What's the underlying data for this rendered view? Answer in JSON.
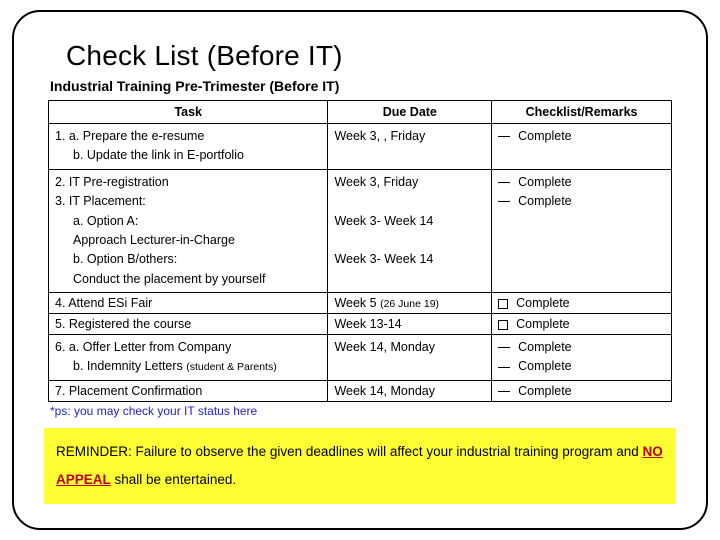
{
  "title": "Check List (Before IT)",
  "subtitle": "Industrial Training Pre-Trimester (Before IT)",
  "table": {
    "headers": {
      "task": "Task",
      "due": "Due Date",
      "remark": "Checklist/Remarks"
    },
    "rows": {
      "r1": {
        "task_a": "1.  a. Prepare the e-resume",
        "task_b": "b. Update the link in E-portfolio",
        "due": "Week 3, , Friday",
        "remark": "Complete"
      },
      "r2": {
        "task_2": "2. IT Pre-registration",
        "task_3": "3. IT Placement:",
        "task_a": "a. Option A:",
        "task_a2": "Approach Lecturer-in-Charge",
        "task_b": "b. Option B/others:",
        "task_b2": "Conduct the placement by yourself",
        "due_2": "Week 3, Friday",
        "due_a": "Week 3- Week 14",
        "due_b": "Week 3- Week 14",
        "remark_2": "Complete",
        "remark_3": "Complete"
      },
      "r4": {
        "task": "4. Attend ESi Fair",
        "due_main": "Week 5 ",
        "due_note": "(26 June 19)",
        "remark": "Complete"
      },
      "r5": {
        "task": "5. Registered the course",
        "due": "Week 13-14",
        "remark": "Complete"
      },
      "r6": {
        "task_a": "6. a. Offer Letter from Company",
        "task_b_pre": "b. Indemnity Letters ",
        "task_b_note": "(student & Parents)",
        "due": "Week 14, Monday",
        "remark_a": "Complete",
        "remark_b": "Complete"
      },
      "r7": {
        "task": "7. Placement Confirmation",
        "due": "Week 14, Monday",
        "remark": "Complete"
      }
    }
  },
  "footnote": "*ps: you may check your IT status here",
  "reminder": {
    "pre": "REMINDER: Failure to observe the given deadlines will affect your industrial training program and ",
    "noappeal": "NO APPEAL",
    "post": " shall be entertained."
  }
}
